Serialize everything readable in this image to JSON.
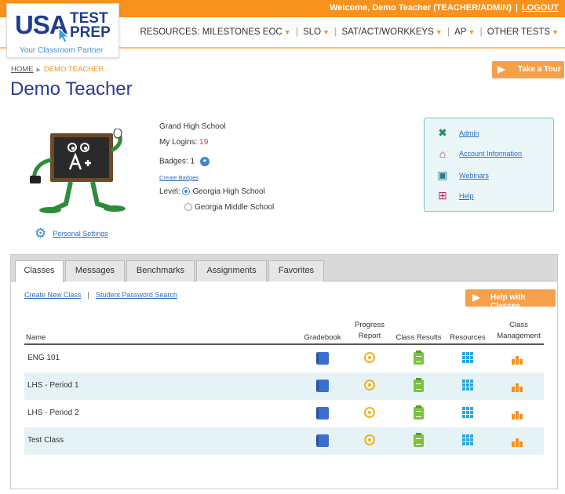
{
  "header": {
    "welcome_text": "Welcome, Demo Teacher (TEACHER/ADMIN)",
    "separator": "|",
    "logout_label": "LOGOUT",
    "logo_usa": "USA",
    "logo_test": "TEST",
    "logo_prep": "PREP",
    "logo_tagline": "Your Classroom Partner",
    "accent_color": "#f7921e",
    "nav": {
      "resources_label": "RESOURCES:",
      "items": [
        "MILESTONES EOC",
        "SLO",
        "SAT/ACT/WORKKEYS",
        "AP",
        "OTHER TESTS"
      ]
    }
  },
  "breadcrumb": {
    "home": "HOME",
    "current": "DEMO TEACHER"
  },
  "page_title": "Demo Teacher",
  "tour_button": "Take a Tour",
  "profile": {
    "school": "Grand High School",
    "logins_label": "My Logins:",
    "logins_value": "19",
    "badges_label": "Badges:",
    "badges_value": "1",
    "create_badges": "Create Badges",
    "level_label": "Level:",
    "level_options": [
      "Georgia High School",
      "Georgia Middle School"
    ],
    "personal_settings": "Personal Settings"
  },
  "admin_links": [
    "Admin",
    "Account Information",
    "Webinars",
    "Help"
  ],
  "tabs": [
    "Classes",
    "Messages",
    "Benchmarks",
    "Assignments",
    "Favorites"
  ],
  "class_links": {
    "create": "Create New Class",
    "separator": "|",
    "password": "Student Password Search"
  },
  "help_button": "Help with Classes",
  "table": {
    "headers": {
      "name": "Name",
      "gradebook": "Gradebook",
      "progress_1": "Progress",
      "progress_2": "Report",
      "class_results": "Class Results",
      "resources": "Resources",
      "management_1": "Class",
      "management_2": "Management"
    },
    "rows": [
      {
        "name": "ENG 101"
      },
      {
        "name": "LHS - Period 1"
      },
      {
        "name": "LHS - Period 2"
      },
      {
        "name": "Test Class"
      }
    ]
  }
}
